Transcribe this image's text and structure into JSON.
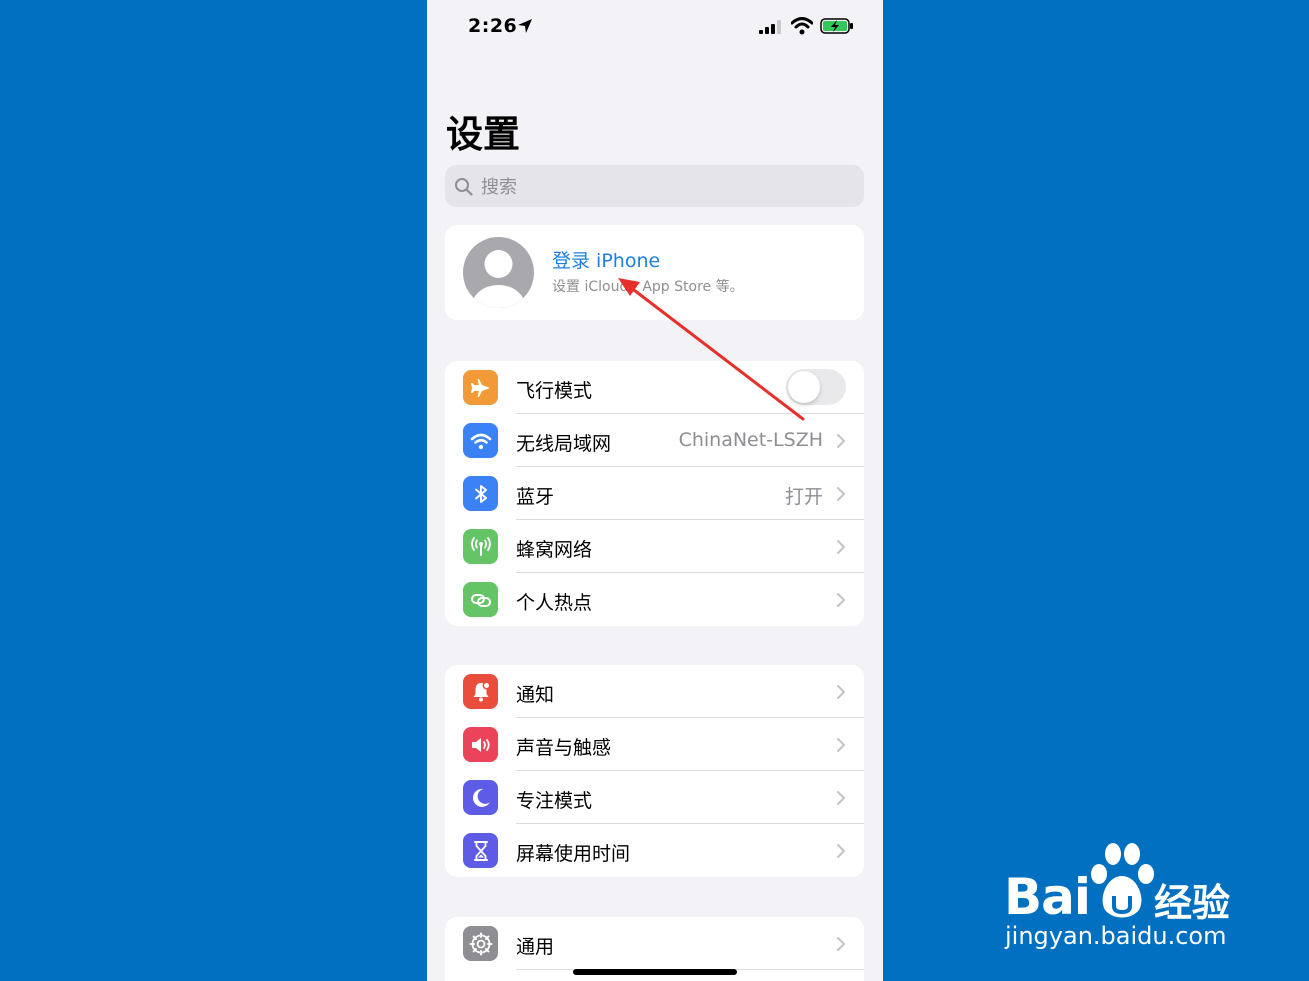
{
  "status_bar": {
    "time": "2:26"
  },
  "page_title": "设置",
  "search": {
    "placeholder": "搜索"
  },
  "account": {
    "title": "登录 iPhone",
    "subtitle": "设置 iCloud、App Store 等。"
  },
  "group1": [
    {
      "label": "飞行模式",
      "icon": "airplane-icon",
      "color": "#f19a37",
      "toggle": false
    },
    {
      "label": "无线局域网",
      "icon": "wifi-icon",
      "color": "#3b82f6",
      "value": "ChinaNet-LSZH"
    },
    {
      "label": "蓝牙",
      "icon": "bluetooth-icon",
      "color": "#3b82f6",
      "value": "打开"
    },
    {
      "label": "蜂窝网络",
      "icon": "antenna-icon",
      "color": "#65c466"
    },
    {
      "label": "个人热点",
      "icon": "hotspot-link-icon",
      "color": "#65c466"
    }
  ],
  "group2": [
    {
      "label": "通知",
      "icon": "bell-icon",
      "color": "#eb4d3d"
    },
    {
      "label": "声音与触感",
      "icon": "speaker-icon",
      "color": "#eb445a"
    },
    {
      "label": "专注模式",
      "icon": "moon-icon",
      "color": "#5e5ce6"
    },
    {
      "label": "屏幕使用时间",
      "icon": "hourglass-icon",
      "color": "#5e5ce6"
    }
  ],
  "group3": [
    {
      "label": "通用",
      "icon": "gear-icon",
      "color": "#8e8e93"
    }
  ],
  "watermark": {
    "brand": "Bai",
    "brand_cn": "经验",
    "url": "jingyan.baidu.com"
  }
}
